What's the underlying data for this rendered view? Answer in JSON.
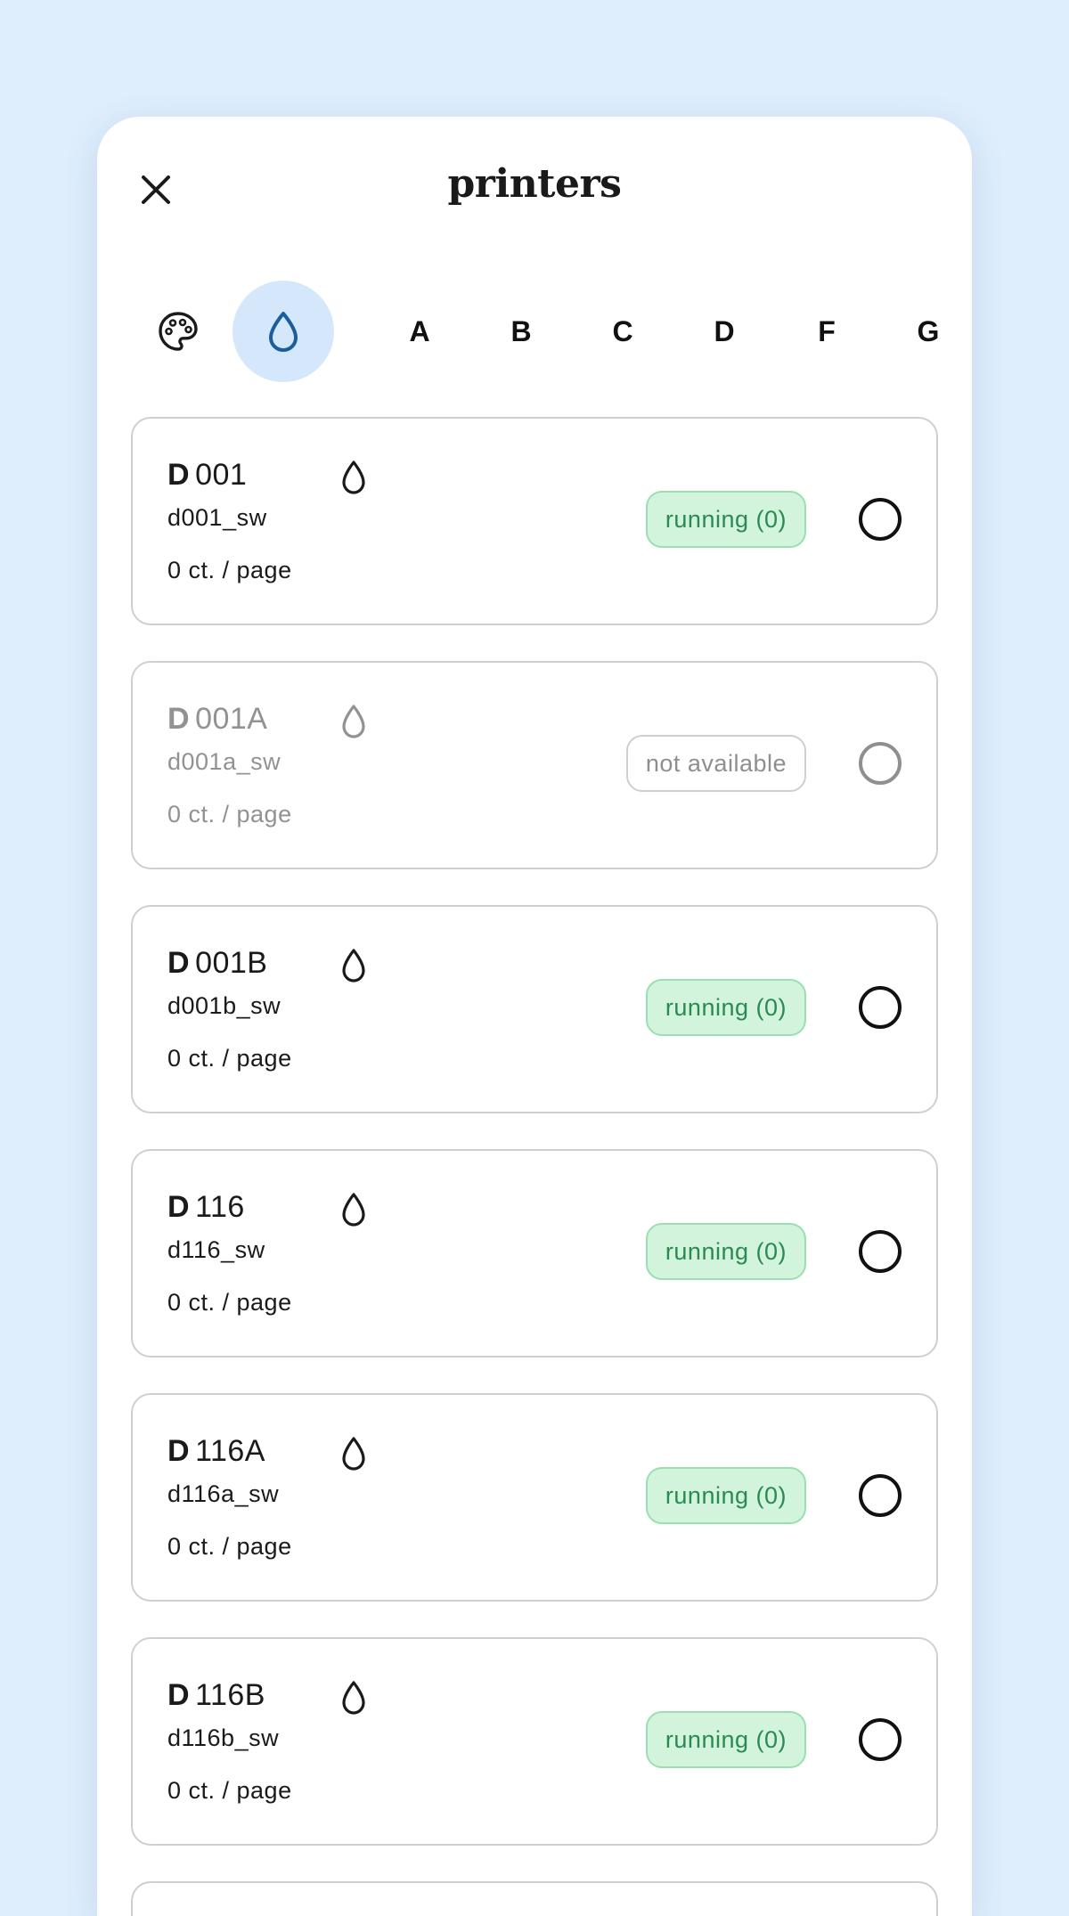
{
  "title": "printers",
  "filters": [
    {
      "type": "icon",
      "icon": "palette-icon",
      "active": false
    },
    {
      "type": "icon",
      "icon": "ink-drop-icon",
      "active": true
    },
    {
      "type": "letter",
      "label": "A"
    },
    {
      "type": "letter",
      "label": "B"
    },
    {
      "type": "letter",
      "label": "C"
    },
    {
      "type": "letter",
      "label": "D"
    },
    {
      "type": "letter",
      "label": "F"
    },
    {
      "type": "letter",
      "label": "G"
    }
  ],
  "printers": [
    {
      "prefix": "D",
      "name": "001",
      "queue": "d001_sw",
      "price": "0 ct. / page",
      "status": "running (0)",
      "available": true,
      "icon": "ink-drop-icon"
    },
    {
      "prefix": "D",
      "name": "001A",
      "queue": "d001a_sw",
      "price": "0 ct. / page",
      "status": "not available",
      "available": false,
      "icon": "ink-drop-icon"
    },
    {
      "prefix": "D",
      "name": "001B",
      "queue": "d001b_sw",
      "price": "0 ct. / page",
      "status": "running (0)",
      "available": true,
      "icon": "ink-drop-icon"
    },
    {
      "prefix": "D",
      "name": "116",
      "queue": "d116_sw",
      "price": "0 ct. / page",
      "status": "running (0)",
      "available": true,
      "icon": "ink-drop-icon"
    },
    {
      "prefix": "D",
      "name": "116A",
      "queue": "d116a_sw",
      "price": "0 ct. / page",
      "status": "running (0)",
      "available": true,
      "icon": "ink-drop-icon"
    },
    {
      "prefix": "D",
      "name": "116B",
      "queue": "d116b_sw",
      "price": "0 ct. / page",
      "status": "running (0)",
      "available": true,
      "icon": "ink-drop-icon"
    }
  ],
  "colors": {
    "background": "#deeefd",
    "active_filter": "#d5e8fb",
    "active_icon": "#1a5e9c",
    "running_bg": "#d2f4dd",
    "running_text": "#2a8a51",
    "disabled_text": "#929292"
  }
}
